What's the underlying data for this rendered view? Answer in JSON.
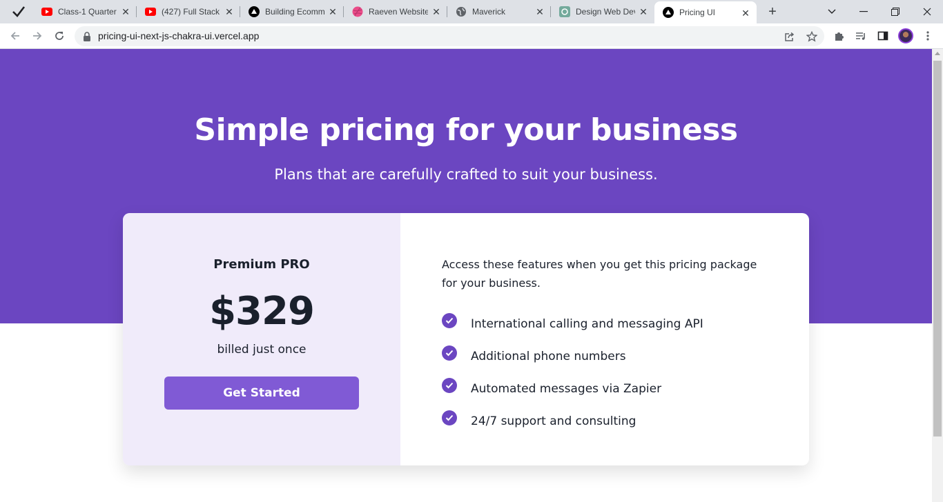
{
  "browser": {
    "tabs": [
      {
        "title": "Class-1 Quarter",
        "favicon": "youtube-icon"
      },
      {
        "title": "(427) Full Stack",
        "favicon": "youtube-icon"
      },
      {
        "title": "Building Ecomm",
        "favicon": "vercel-icon"
      },
      {
        "title": "Raeven Website",
        "favicon": "dribbble-icon"
      },
      {
        "title": "Maverick",
        "favicon": "globe-icon"
      },
      {
        "title": "Design Web Dev",
        "favicon": "chatgpt-icon"
      },
      {
        "title": "Pricing UI",
        "favicon": "vercel-icon",
        "active": true
      }
    ],
    "url": "pricing-ui-next-js-chakra-ui.vercel.app"
  },
  "hero": {
    "title": "Simple pricing for your business",
    "subtitle": "Plans that are carefully crafted to suit your business."
  },
  "plan": {
    "name": "Premium PRO",
    "price": "$329",
    "billing": "billed just once",
    "cta_label": "Get Started"
  },
  "details": {
    "intro": "Access these features when you get this pricing package for your business.",
    "features": [
      "International calling and messaging API",
      "Additional phone numbers",
      "Automated messages via Zapier",
      "24/7 support and consulting"
    ]
  },
  "colors": {
    "hero_bg": "#6b46c1",
    "plan_panel_bg": "#f0ebfa",
    "cta_bg": "#805ad5",
    "check_bg": "#6b46c1"
  }
}
